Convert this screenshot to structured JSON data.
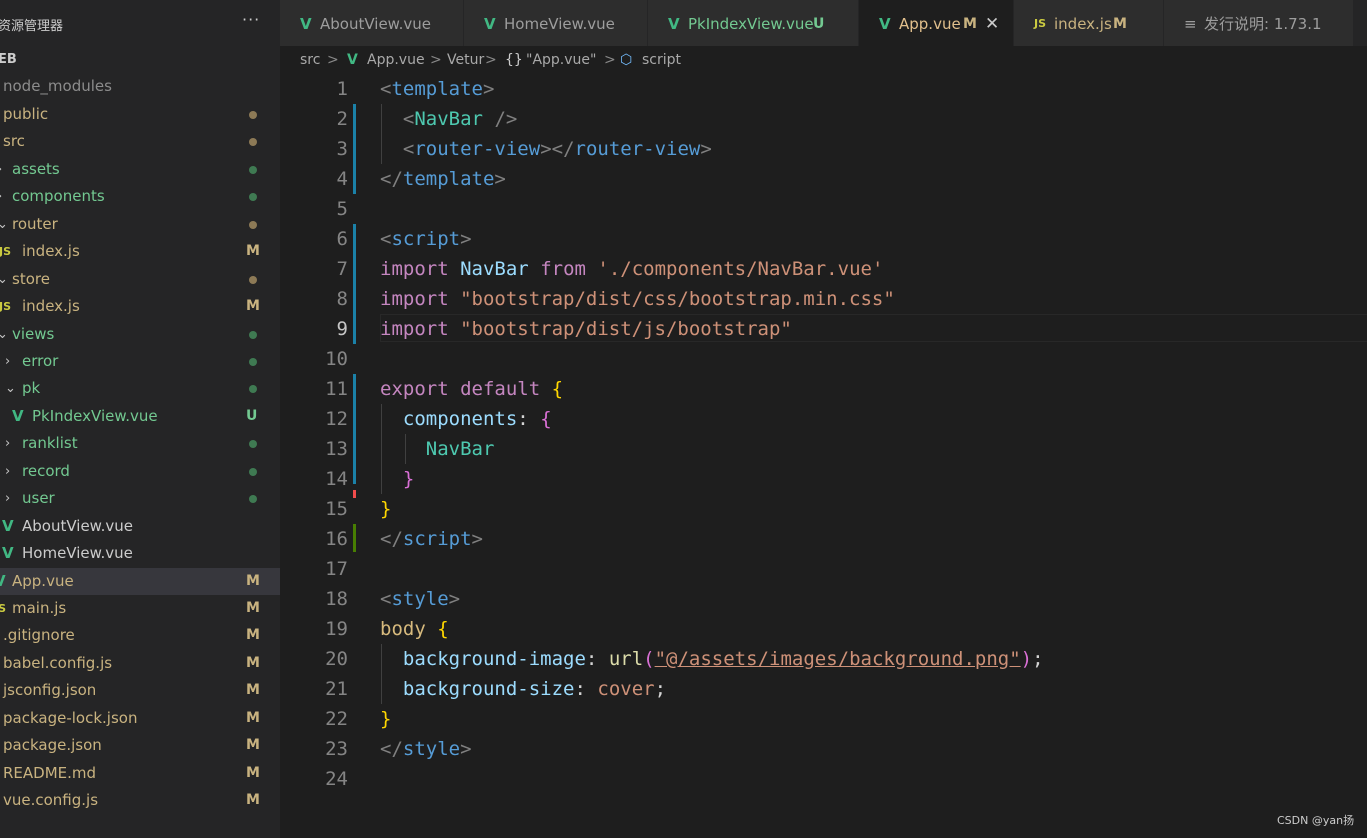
{
  "explorer": {
    "title": "资源管理器",
    "more": "···",
    "items": [
      {
        "label": "EB",
        "kind": "root"
      },
      {
        "label": "node_modules",
        "kind": "folder",
        "color": "gray"
      },
      {
        "label": "public",
        "kind": "folder",
        "status": "dot"
      },
      {
        "label": "src",
        "kind": "folder",
        "status": "dot"
      },
      {
        "label": "assets",
        "kind": "folder",
        "status": "dot"
      },
      {
        "label": "components",
        "kind": "folder",
        "status": "dot"
      },
      {
        "label": "router",
        "kind": "folder",
        "status": "dot"
      },
      {
        "label": "index.js",
        "kind": "js",
        "status": "M"
      },
      {
        "label": "store",
        "kind": "folder",
        "status": "dot"
      },
      {
        "label": "index.js",
        "kind": "js",
        "status": "M"
      },
      {
        "label": "views",
        "kind": "folder",
        "status": "dot"
      },
      {
        "label": "error",
        "kind": "folder",
        "status": "dot"
      },
      {
        "label": "pk",
        "kind": "folder",
        "status": "dot"
      },
      {
        "label": "PkIndexView.vue",
        "kind": "vue",
        "status": "U"
      },
      {
        "label": "ranklist",
        "kind": "folder",
        "status": "dot"
      },
      {
        "label": "record",
        "kind": "folder",
        "status": "dot"
      },
      {
        "label": "user",
        "kind": "folder",
        "status": "dot"
      },
      {
        "label": "AboutView.vue",
        "kind": "vue"
      },
      {
        "label": "HomeView.vue",
        "kind": "vue"
      },
      {
        "label": "App.vue",
        "kind": "vue",
        "status": "M",
        "active": true
      },
      {
        "label": "main.js",
        "kind": "js",
        "status": "M"
      },
      {
        "label": ".gitignore",
        "kind": "file",
        "status": "M"
      },
      {
        "label": "babel.config.js",
        "kind": "file",
        "status": "M"
      },
      {
        "label": "jsconfig.json",
        "kind": "file",
        "status": "M"
      },
      {
        "label": "package-lock.json",
        "kind": "file",
        "status": "M"
      },
      {
        "label": "package.json",
        "kind": "file",
        "status": "M"
      },
      {
        "label": "README.md",
        "kind": "file",
        "status": "M"
      },
      {
        "label": "vue.config.js",
        "kind": "file",
        "status": "M"
      }
    ]
  },
  "tabs": [
    {
      "label": "AboutView.vue",
      "icon": "vue"
    },
    {
      "label": "HomeView.vue",
      "icon": "vue"
    },
    {
      "label": "PkIndexView.vue",
      "icon": "vue",
      "badge": "U"
    },
    {
      "label": "App.vue",
      "icon": "vue",
      "badge": "M",
      "active": true,
      "close": "✕"
    },
    {
      "label": "index.js",
      "icon": "js",
      "badge": "M"
    },
    {
      "label": "发行说明: 1.73.1",
      "icon": "doc"
    }
  ],
  "breadcrumb": {
    "src": "src",
    "file": "App.vue",
    "vetur": "Vetur",
    "block": "\"App.vue\"",
    "symbol": "script",
    "sep": ">"
  },
  "editor": {
    "line_numbers": [
      "1",
      "2",
      "3",
      "4",
      "5",
      "6",
      "7",
      "8",
      "9",
      "10",
      "11",
      "12",
      "13",
      "14",
      "15",
      "16",
      "17",
      "18",
      "19",
      "20",
      "21",
      "22",
      "23",
      "24"
    ],
    "current_line": 9
  },
  "watermark": "CSDN @yan扬",
  "colors": {
    "bg": "#1e1e1e",
    "sidebar": "#252526",
    "modified": "#c9b380",
    "untracked": "#73c991",
    "vue": "#41b883",
    "js": "#cbcb41"
  }
}
